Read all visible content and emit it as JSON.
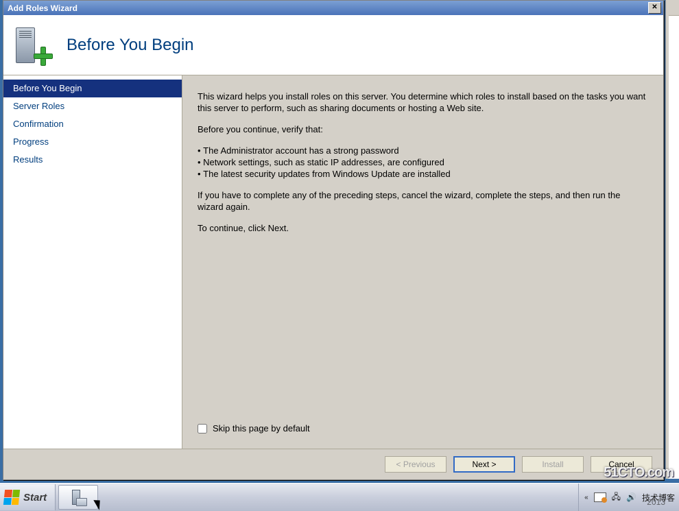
{
  "window": {
    "title": "Add Roles Wizard"
  },
  "header": {
    "page_title": "Before You Begin"
  },
  "sidebar": {
    "items": [
      {
        "label": "Before You Begin",
        "selected": true
      },
      {
        "label": "Server Roles",
        "selected": false
      },
      {
        "label": "Confirmation",
        "selected": false
      },
      {
        "label": "Progress",
        "selected": false
      },
      {
        "label": "Results",
        "selected": false
      }
    ]
  },
  "content": {
    "intro": "This wizard helps you install roles on this server. You determine which roles to install based on the tasks you want this server to perform, such as sharing documents or hosting a Web site.",
    "verify_heading": "Before you continue, verify that:",
    "bullets": [
      "The Administrator account has a strong password",
      "Network settings, such as static IP addresses, are configured",
      "The latest security updates from Windows Update are installed"
    ],
    "after_bullets": "If you have to complete any of the preceding steps, cancel the wizard, complete the steps, and then run the wizard again.",
    "continue_line": "To continue, click Next.",
    "skip_label": "Skip this page by default",
    "skip_checked": false
  },
  "footer": {
    "previous": "< Previous",
    "next": "Next >",
    "install": "Install",
    "cancel": "Cancel"
  },
  "taskbar": {
    "start": "Start",
    "tray_text": "技术博客",
    "tray_year": "2013"
  },
  "watermark": "51CTO.com"
}
